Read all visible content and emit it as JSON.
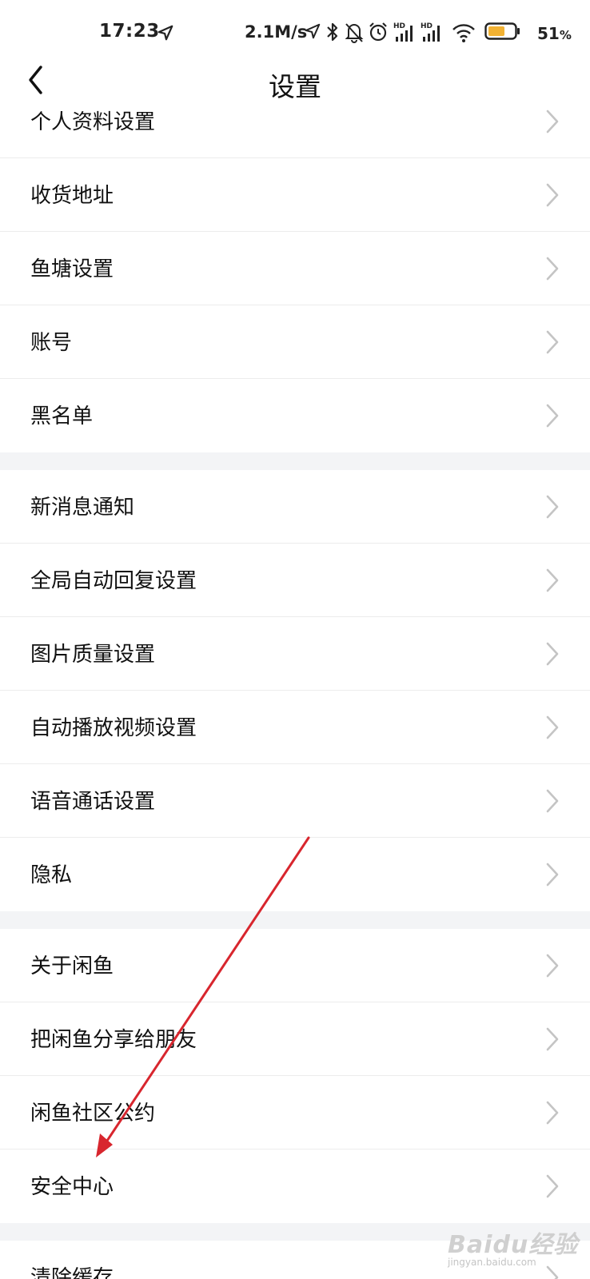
{
  "status_bar": {
    "time": "17:23",
    "network_speed": "2.1M/s",
    "signal_hd_1": "HD",
    "signal_hd_2": "HD",
    "battery_percent": "51",
    "battery_unit": "%",
    "battery_level": 0.51,
    "icons": [
      "location-arrow-icon",
      "bluetooth-icon",
      "bell-muted-icon",
      "alarm-icon",
      "signal-icon",
      "signal-icon",
      "wifi-icon",
      "battery-icon"
    ]
  },
  "nav": {
    "back_icon": "chevron-left-icon",
    "title": "设置"
  },
  "sections": [
    {
      "items": [
        {
          "label": "个人资料设置"
        },
        {
          "label": "收货地址"
        },
        {
          "label": "鱼塘设置"
        },
        {
          "label": "账号"
        },
        {
          "label": "黑名单"
        }
      ]
    },
    {
      "items": [
        {
          "label": "新消息通知"
        },
        {
          "label": "全局自动回复设置"
        },
        {
          "label": "图片质量设置"
        },
        {
          "label": "自动播放视频设置"
        },
        {
          "label": "语音通话设置"
        },
        {
          "label": "隐私"
        }
      ]
    },
    {
      "items": [
        {
          "label": "关于闲鱼"
        },
        {
          "label": "把闲鱼分享给朋友"
        },
        {
          "label": "闲鱼社区公约"
        },
        {
          "label": "安全中心"
        }
      ]
    },
    {
      "items": [
        {
          "label": "清除缓存"
        }
      ]
    }
  ],
  "chevron_icon": "chevron-right-icon",
  "annotation": {
    "type": "arrow",
    "color": "#d8262e"
  },
  "watermark": {
    "text": "Baidu经验",
    "sub": "jingyan.baidu.com"
  },
  "colors": {
    "background": "#ffffff",
    "section_gap": "#f3f4f6",
    "divider": "#ececec",
    "text": "#111111",
    "chevron": "#c4c4c4",
    "battery_fill": "#f2b233"
  }
}
